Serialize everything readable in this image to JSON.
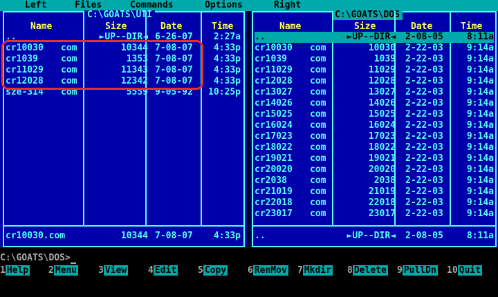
{
  "menu": {
    "left": "Left",
    "files": "Files",
    "commands": "Commands",
    "options": "Options",
    "right": "Right"
  },
  "left_panel": {
    "title": "C:\\GOATS\\UTI",
    "headers": {
      "name": "Name",
      "size": "Size",
      "date": "Date",
      "time": "Time"
    },
    "rows": [
      {
        "name": "..",
        "ext": "",
        "size": "►UP--DIR◄",
        "date": "6-26-07",
        "time": "2:27a"
      },
      {
        "name": "cr10030",
        "ext": "com",
        "size": "10344",
        "date": "7-08-07",
        "time": "4:33p"
      },
      {
        "name": "cr1039",
        "ext": "com",
        "size": "1353",
        "date": "7-08-07",
        "time": "4:33p"
      },
      {
        "name": "cr11029",
        "ext": "com",
        "size": "11343",
        "date": "7-08-07",
        "time": "4:33p"
      },
      {
        "name": "cr12028",
        "ext": "com",
        "size": "12342",
        "date": "7-08-07",
        "time": "4:33p"
      },
      {
        "name": "sze-314",
        "ext": "com",
        "size": "5559",
        "date": "9-05-92",
        "time": "10:25p"
      }
    ],
    "status": {
      "name": "cr10030.com",
      "size": "10344",
      "date": "7-08-07",
      "time": "4:33p"
    }
  },
  "right_panel": {
    "title": "C:\\GOATS\\DOS",
    "headers": {
      "name": "Name",
      "size": "Size",
      "date": "Date",
      "time": "Time"
    },
    "rows": [
      {
        "name": "..",
        "ext": "",
        "size": "►UP--DIR◄",
        "date": "2-08-05",
        "time": "8:11a"
      },
      {
        "name": "cr10030",
        "ext": "com",
        "size": "10030",
        "date": "2-22-03",
        "time": "9:14a"
      },
      {
        "name": "cr1039",
        "ext": "com",
        "size": "1039",
        "date": "2-22-03",
        "time": "9:14a"
      },
      {
        "name": "cr11029",
        "ext": "com",
        "size": "11029",
        "date": "2-22-03",
        "time": "9:14a"
      },
      {
        "name": "cr12028",
        "ext": "com",
        "size": "12028",
        "date": "2-22-03",
        "time": "9:14a"
      },
      {
        "name": "cr13027",
        "ext": "com",
        "size": "13027",
        "date": "2-22-03",
        "time": "9:14a"
      },
      {
        "name": "cr14026",
        "ext": "com",
        "size": "14026",
        "date": "2-22-03",
        "time": "9:14a"
      },
      {
        "name": "cr15025",
        "ext": "com",
        "size": "15025",
        "date": "2-22-03",
        "time": "9:14a"
      },
      {
        "name": "cr16024",
        "ext": "com",
        "size": "16024",
        "date": "2-22-03",
        "time": "9:14a"
      },
      {
        "name": "cr17023",
        "ext": "com",
        "size": "17023",
        "date": "2-22-03",
        "time": "9:14a"
      },
      {
        "name": "cr18022",
        "ext": "com",
        "size": "18022",
        "date": "2-22-03",
        "time": "9:14a"
      },
      {
        "name": "cr19021",
        "ext": "com",
        "size": "19021",
        "date": "2-22-03",
        "time": "9:14a"
      },
      {
        "name": "cr20020",
        "ext": "com",
        "size": "20020",
        "date": "2-22-03",
        "time": "9:14a"
      },
      {
        "name": "cr2038",
        "ext": "com",
        "size": "2038",
        "date": "2-22-03",
        "time": "9:14a"
      },
      {
        "name": "cr21019",
        "ext": "com",
        "size": "21019",
        "date": "2-22-03",
        "time": "9:14a"
      },
      {
        "name": "cr22018",
        "ext": "com",
        "size": "22018",
        "date": "2-22-03",
        "time": "9:14a"
      },
      {
        "name": "cr23017",
        "ext": "com",
        "size": "23017",
        "date": "2-22-03",
        "time": "9:14a"
      }
    ],
    "status": {
      "name": "..",
      "size": "►UP--DIR◄",
      "date": "2-08-05",
      "time": "8:11a"
    }
  },
  "command_line": {
    "prompt": "C:\\GOATS\\DOS>"
  },
  "fkeys": [
    {
      "num": "1",
      "label": "Help"
    },
    {
      "num": "2",
      "label": "Menu"
    },
    {
      "num": "3",
      "label": "View"
    },
    {
      "num": "4",
      "label": "Edit"
    },
    {
      "num": "5",
      "label": "Copy"
    },
    {
      "num": "6",
      "label": "RenMov"
    },
    {
      "num": "7",
      "label": "Mkdir"
    },
    {
      "num": "8",
      "label": "Delete"
    },
    {
      "num": "9",
      "label": "PullDn"
    },
    {
      "num": "10",
      "label": "Quit"
    }
  ],
  "colors": {
    "panel_bg": "#0000aa",
    "text": "#55ffff",
    "header": "#ffff55",
    "selection": "#00aaaa",
    "annotation": "#e8302a"
  }
}
